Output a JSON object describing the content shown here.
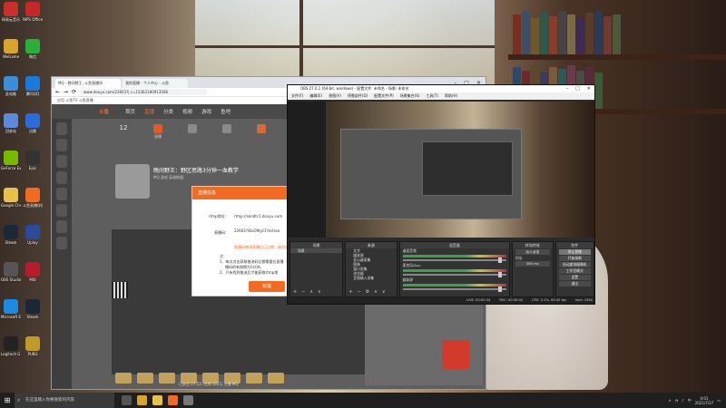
{
  "desktop": {
    "icons": [
      {
        "label": "网易云音乐"
      },
      {
        "label": "WeGame"
      },
      {
        "label": "此电脑"
      },
      {
        "label": "回收站"
      },
      {
        "label": "GeForce Experience"
      },
      {
        "label": "Google Chrome"
      },
      {
        "label": "Steam"
      },
      {
        "label": "OBS Studio"
      },
      {
        "label": "Microsoft Edge"
      },
      {
        "label": "Logitech G HUB"
      },
      {
        "label": "WPS Office"
      },
      {
        "label": "微信"
      },
      {
        "label": "腾讯QQ"
      },
      {
        "label": "迅雷"
      },
      {
        "label": "Epic"
      },
      {
        "label": "斗鱼直播伴侣"
      },
      {
        "label": "Uplay"
      },
      {
        "label": "MSI"
      },
      {
        "label": "Steam"
      },
      {
        "label": "PUBG"
      }
    ]
  },
  "browser": {
    "tabs": [
      {
        "label": "MQ - 晚间野王, 斗鱼直播间"
      },
      {
        "label": "我的直播 - 个人中心 - 斗鱼"
      }
    ],
    "url": "www.douyu.com/22603?| c=15362180913566",
    "bookmarks": "应用    斗鱼TV    斗鱼直播",
    "site": {
      "nav": [
        "首页",
        "直播",
        "分类",
        "视频",
        "游戏",
        "鱼吧"
      ],
      "logo": "斗鱼",
      "icon_strip": [
        "12",
        "直播",
        "动态",
        "",
        "",
        ""
      ],
      "room_title": "晚间野王：野区思路3分钟一血教学",
      "room_sub": "MQ    游戏    英雄联盟",
      "status_line": "已关注 27.5万    在线 332万    主播 MQ"
    }
  },
  "modal": {
    "header": "直播信息",
    "rtmp_label": "rtmp地址：",
    "rtmp_value": "rtmp://sendtc1.douyu.com",
    "stream_label": "直播码：",
    "stream_value": "22603?/BuO9tyCF/eclese",
    "warning": "直播码每场直播后已过期，请勿泄露",
    "notes_title": "注：",
    "note1": "1、每次点击获取推流码后都需要在直播",
    "note1b": "播码的有效期为5分钟。",
    "note2": "2、只有找到推流后才能获取rtmp地",
    "confirm": "知道"
  },
  "obs": {
    "title": "OBS 27.0.1 (64-bit, windows) - 配置文件: 未命名 - 场景: 未命名",
    "menu": [
      "文件(F)",
      "编辑(E)",
      "视图(V)",
      "停靠部件(D)",
      "配置文件(P)",
      "场景集合(S)",
      "工具(T)",
      "帮助(H)"
    ],
    "docks": {
      "scenes": {
        "header": "场景",
        "items": [
          "场景"
        ]
      },
      "sources": {
        "header": "来源",
        "items": [
          "文字",
          "媒体源",
          "显示器采集",
          "图像",
          "窗口采集",
          "浏览器",
          "音频输入采集"
        ]
      },
      "mixer": {
        "header": "混音器",
        "channels": [
          {
            "name": "桌面音频",
            "db": "0.0 dB"
          },
          {
            "name": "麦克风/Aux",
            "db": "0.0 dB"
          },
          {
            "name": "媒体源",
            "db": "0.0 dB"
          }
        ]
      },
      "transitions": {
        "header": "转场特效",
        "type": "淡入淡出",
        "duration_label": "时长",
        "duration": "300 ms"
      },
      "controls": {
        "header": "控件",
        "buttons": [
          "停止直播",
          "开始录制",
          "启动虚拟摄像机",
          "工作室模式",
          "设置",
          "退出"
        ]
      }
    },
    "status": [
      "LIVE: 00:00:34",
      "REC: 00:00:00",
      "CPU: 3.1%, 60.00 fps",
      "kb/s: 2580"
    ]
  },
  "taskbar": {
    "search_placeholder": "在这里输入你要搜索的内容",
    "clock_time": "0:01",
    "clock_date": "2021/7/27",
    "lang": "中"
  }
}
